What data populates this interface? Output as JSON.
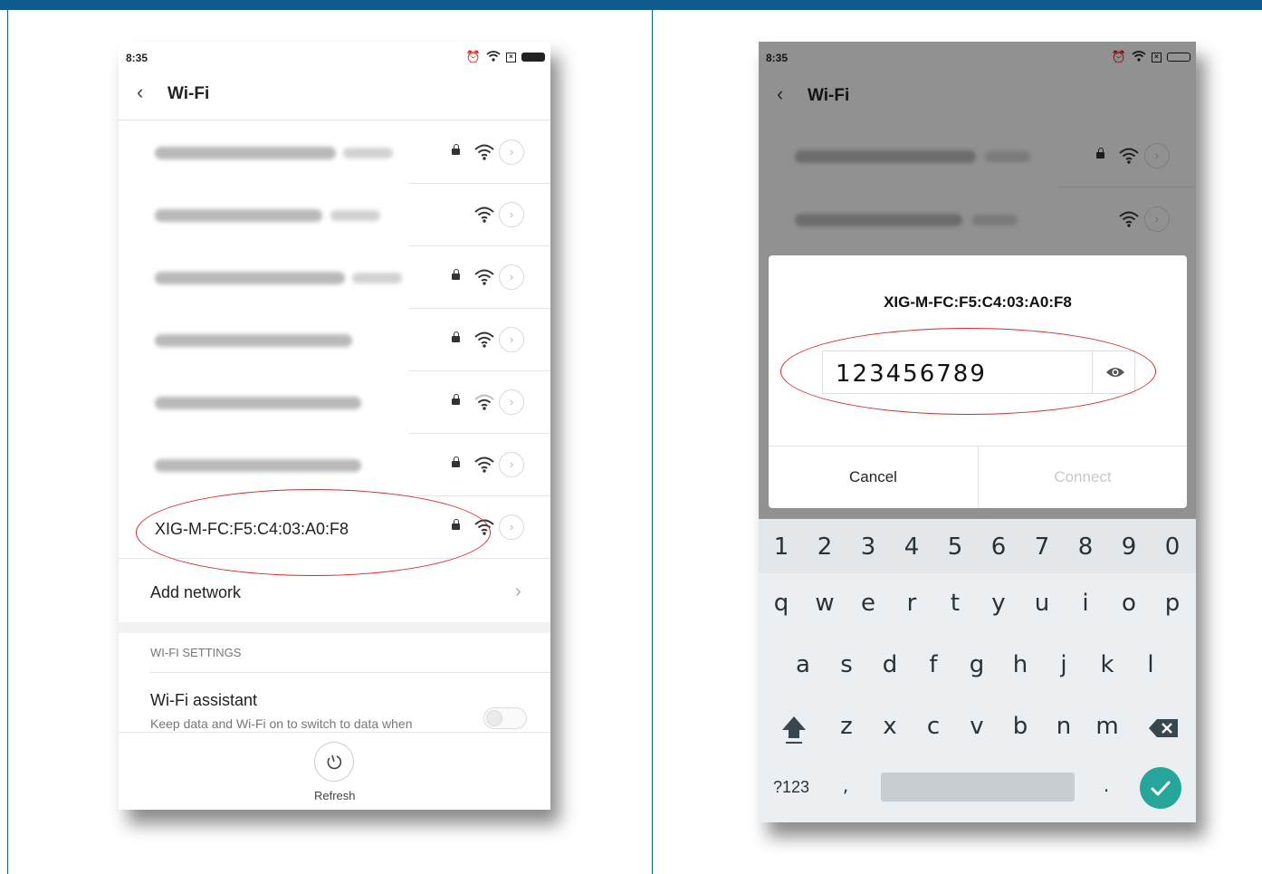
{
  "left_phone": {
    "status_time": "8:35",
    "title": "Wi-Fi",
    "networks": [
      {
        "name": "XIG-M-FC:F5:C4:03:A0:F8",
        "locked": true
      }
    ],
    "add_network": "Add network",
    "section_label": "WI-FI SETTINGS",
    "assistant_title": "Wi-Fi assistant",
    "assistant_desc": "Keep data and Wi-Fi on to switch to data when",
    "refresh_label": "Refresh"
  },
  "right_phone": {
    "status_time": "8:35",
    "title": "Wi-Fi",
    "dialog": {
      "network": "XIG-M-FC:F5:C4:03:A0:F8",
      "password": "123456789",
      "cancel": "Cancel",
      "connect": "Connect"
    },
    "keyboard": {
      "numbers": [
        "1",
        "2",
        "3",
        "4",
        "5",
        "6",
        "7",
        "8",
        "9",
        "0"
      ],
      "row1": [
        "q",
        "w",
        "e",
        "r",
        "t",
        "y",
        "u",
        "i",
        "o",
        "p"
      ],
      "row2": [
        "a",
        "s",
        "d",
        "f",
        "g",
        "h",
        "j",
        "k",
        "l"
      ],
      "row3": [
        "z",
        "x",
        "c",
        "v",
        "b",
        "n",
        "m"
      ],
      "symbols": "?123",
      "comma": ",",
      "period": "."
    }
  },
  "colors": {
    "header_bar": "#0f5a8f",
    "highlight_ellipse": "#d42a2a",
    "enter_key": "#26a69a"
  }
}
